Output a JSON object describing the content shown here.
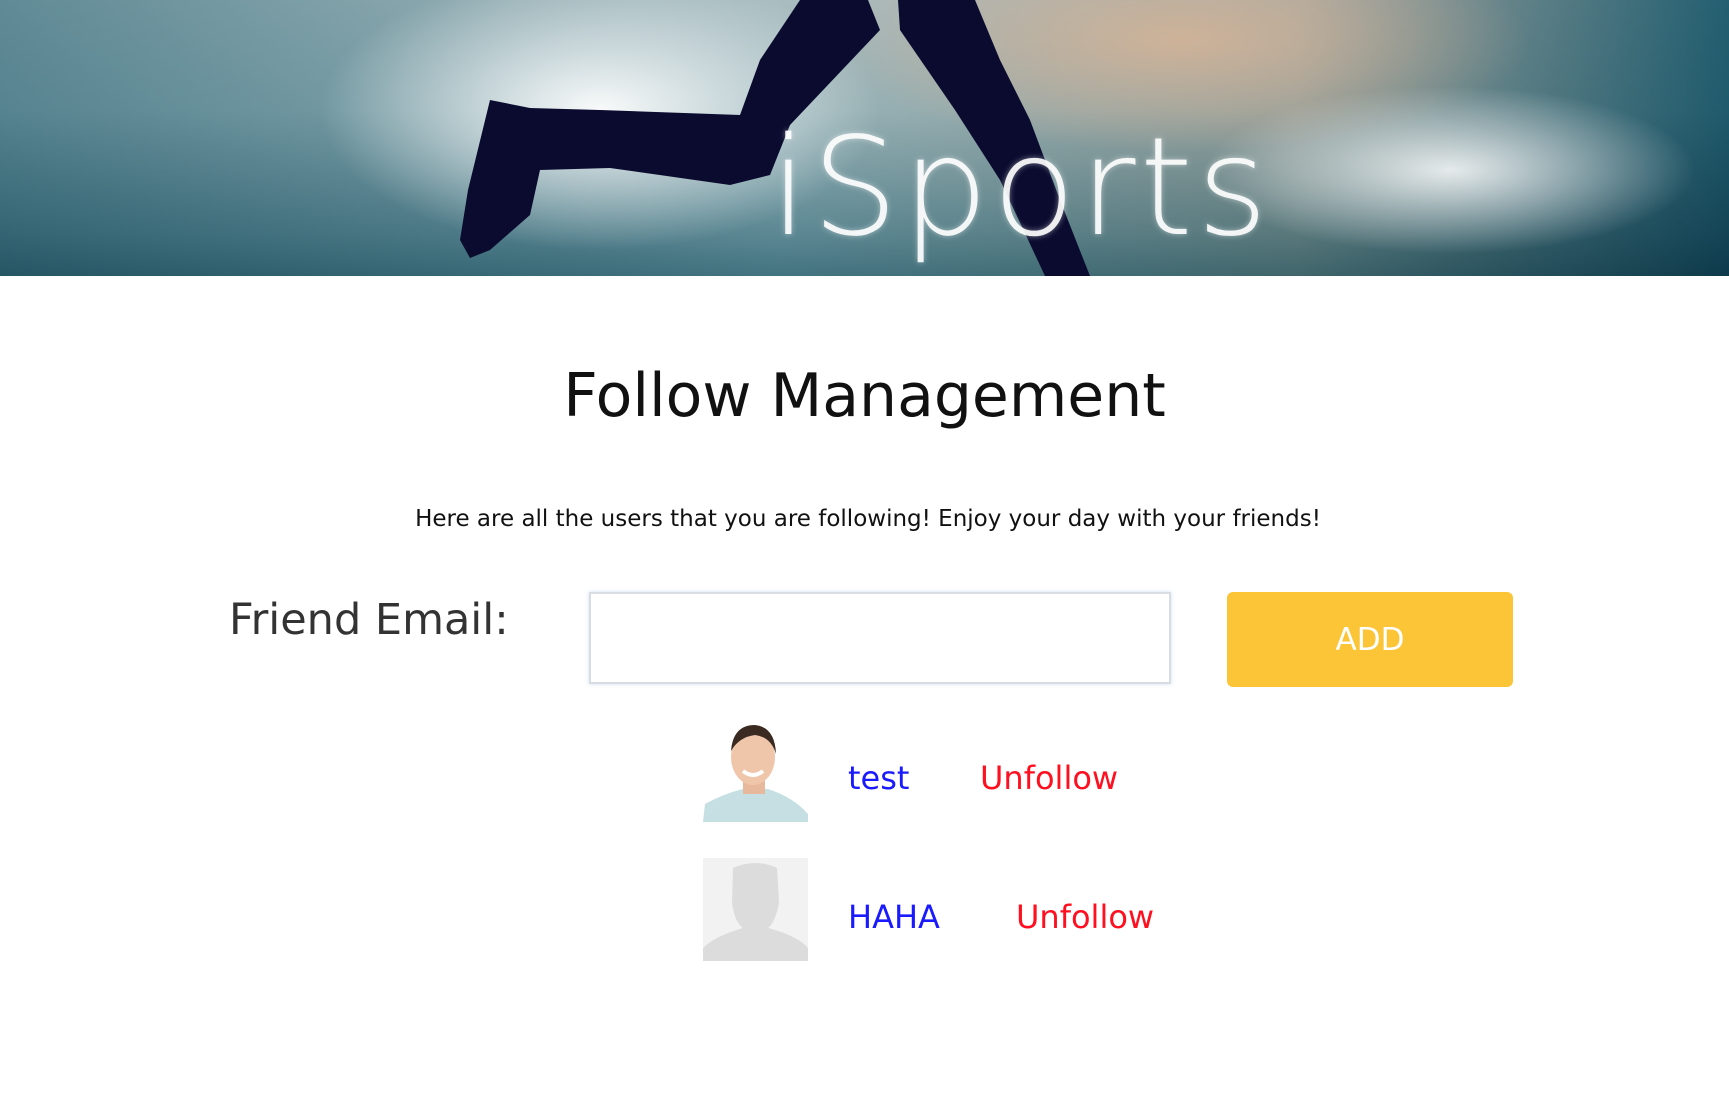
{
  "header": {
    "logo_text": "iSports"
  },
  "page": {
    "title": "Follow Management",
    "subtitle": "Here are all the users that you are following! Enjoy your day with your friends!"
  },
  "form": {
    "label": "Friend Email:",
    "email_value": "",
    "email_placeholder": "",
    "add_label": "ADD"
  },
  "following": [
    {
      "name": "test",
      "avatar": "photo",
      "action": "Unfollow"
    },
    {
      "name": "HAHA",
      "avatar": "default-silhouette",
      "action": "Unfollow"
    }
  ],
  "colors": {
    "accent": "#fcc538",
    "link": "#1a1aff",
    "danger": "#ff1020"
  }
}
